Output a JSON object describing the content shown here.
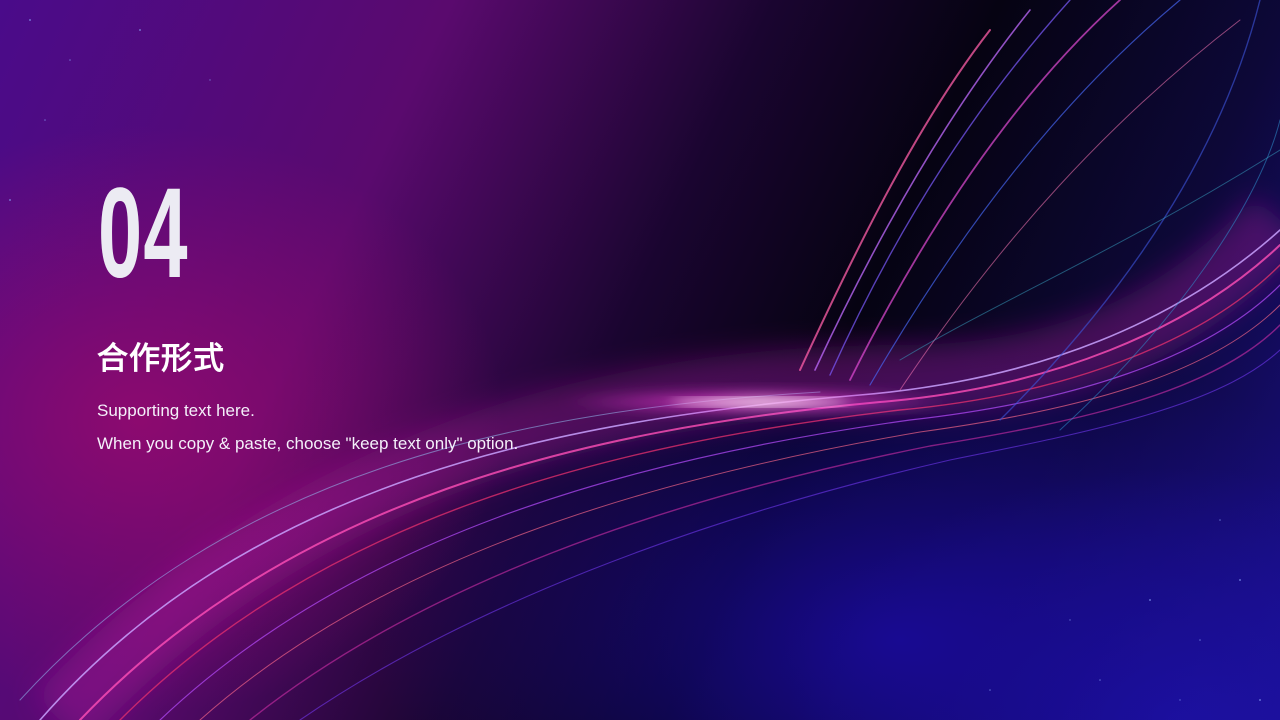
{
  "slide": {
    "section_number": "04",
    "title": "合作形式",
    "support_lines": [
      "Supporting text here.",
      "When you copy & paste, choose \"keep text only\" option."
    ]
  },
  "colors": {
    "background_dark": "#05030f",
    "accent_magenta": "#e83bd0",
    "accent_blue": "#2a1fb8",
    "text_primary": "#ffffff"
  }
}
